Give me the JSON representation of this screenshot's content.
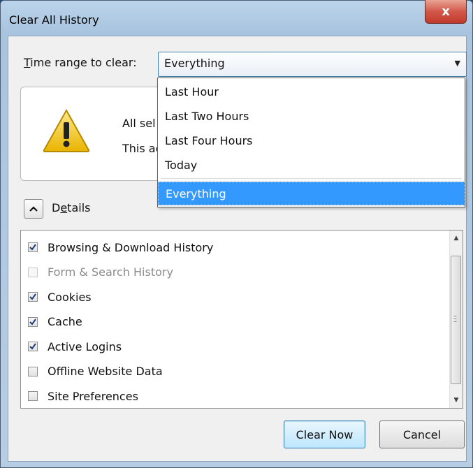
{
  "window": {
    "title": "Clear All History",
    "close_glyph": "x"
  },
  "time_range": {
    "label_prefix": "T",
    "label_rest": "ime range to clear:",
    "selected": "Everything",
    "options": [
      "Last Hour",
      "Last Two Hours",
      "Last Four Hours",
      "Today",
      "Everything"
    ]
  },
  "warning": {
    "line1": "All sel",
    "line2": "This ac",
    "icon": "warning-icon"
  },
  "details": {
    "toggle_glyph": "^",
    "label_prefix": "D",
    "label_underline": "e",
    "label_rest": "tails"
  },
  "history_items": [
    {
      "label": "Browsing & Download History",
      "checked": true,
      "disabled": false
    },
    {
      "label": "Form & Search History",
      "checked": false,
      "disabled": true
    },
    {
      "label": "Cookies",
      "checked": true,
      "disabled": false
    },
    {
      "label": "Cache",
      "checked": true,
      "disabled": false
    },
    {
      "label": "Active Logins",
      "checked": true,
      "disabled": false
    },
    {
      "label": "Offline Website Data",
      "checked": false,
      "disabled": false
    },
    {
      "label": "Site Preferences",
      "checked": false,
      "disabled": false
    }
  ],
  "buttons": {
    "clear_now": "Clear Now",
    "cancel": "Cancel"
  },
  "colors": {
    "highlight": "#3399ff",
    "accent_border": "#3c7fb1",
    "close_red": "#c23a2b"
  }
}
